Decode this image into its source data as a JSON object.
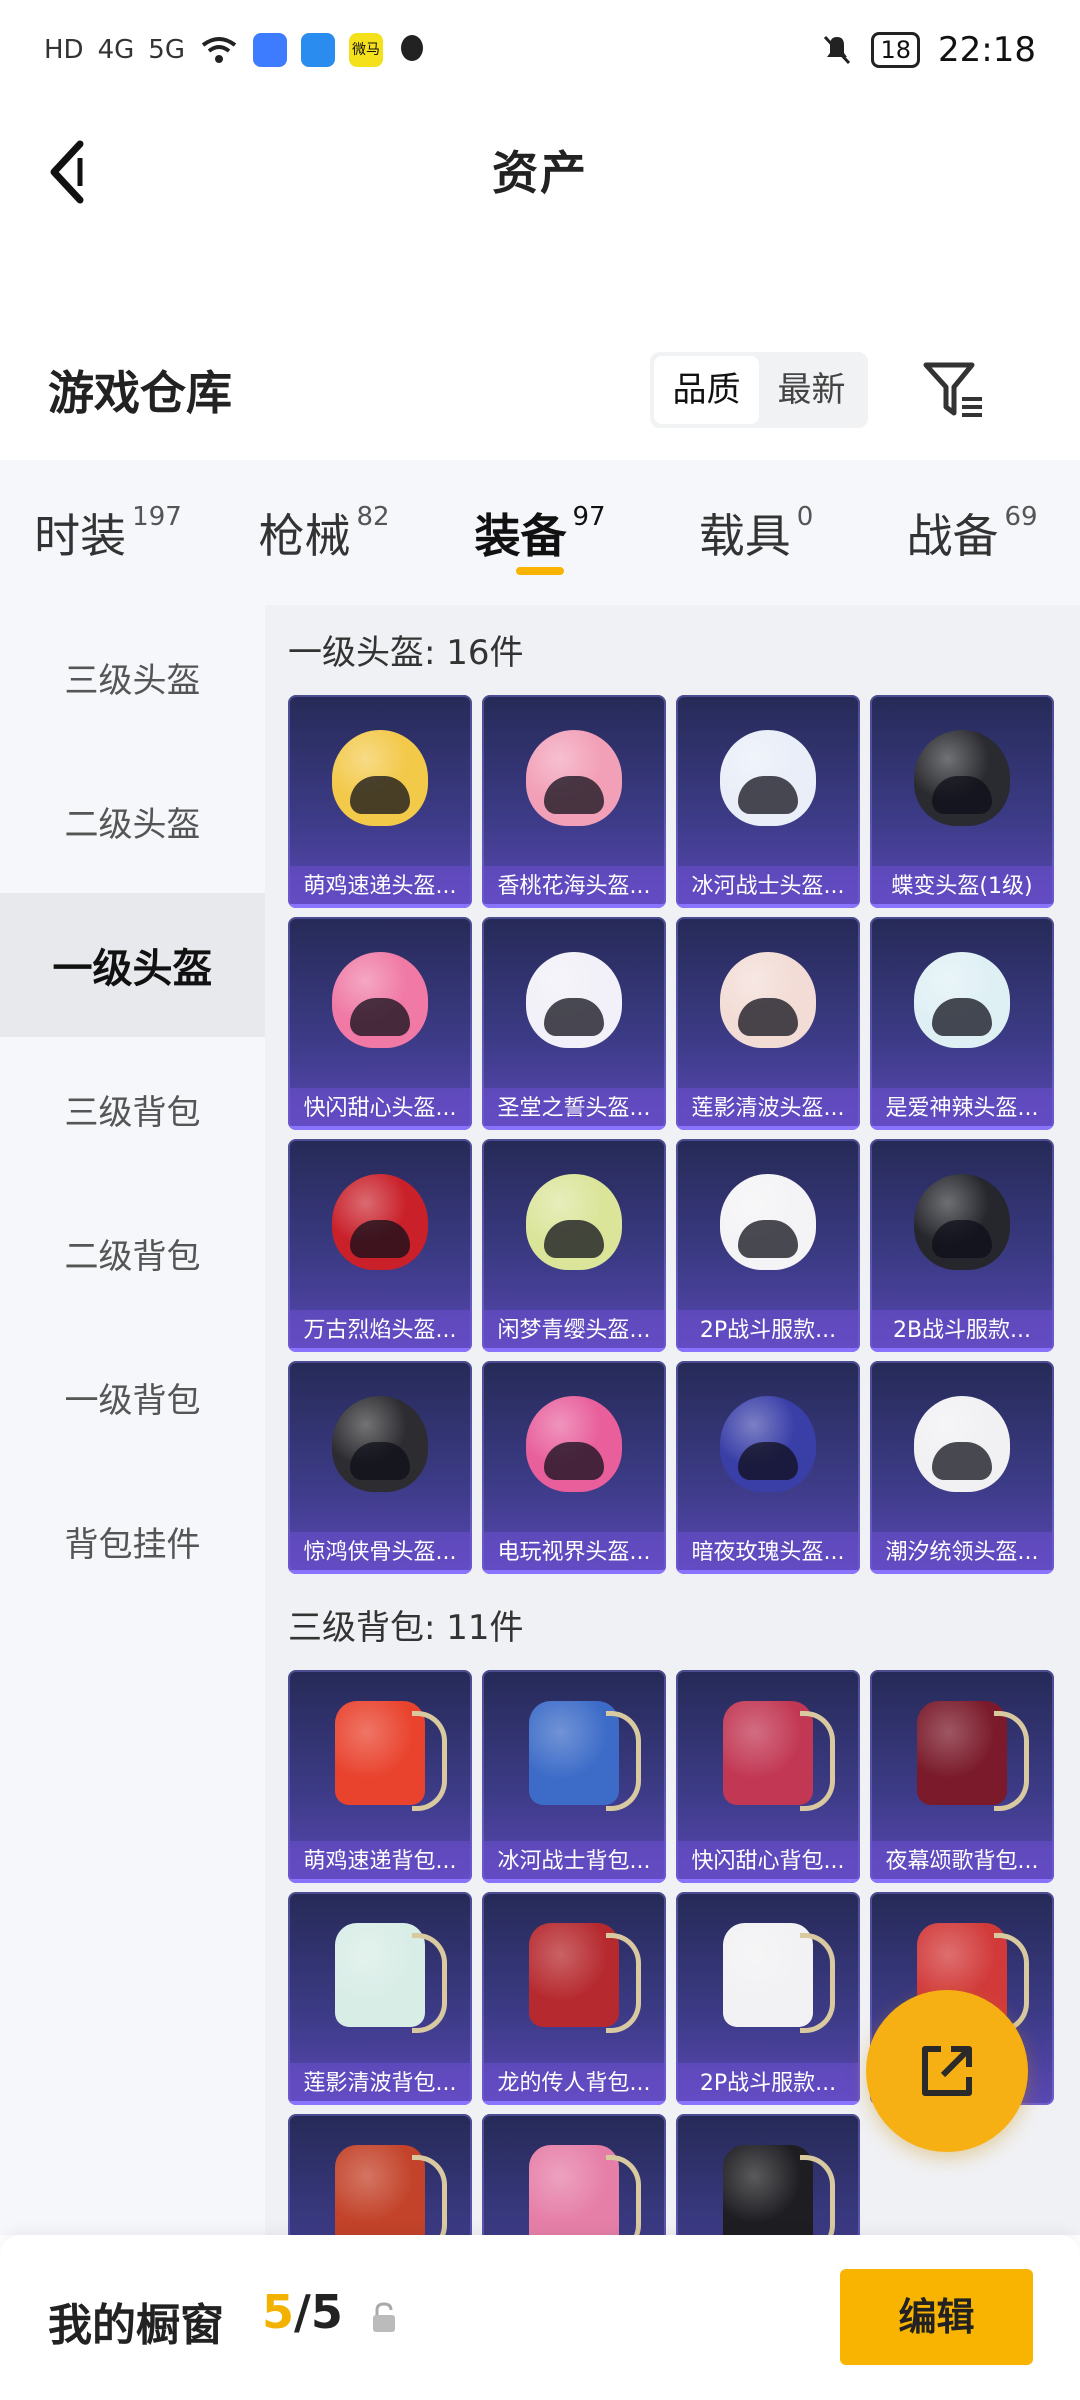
{
  "status_bar": {
    "network_icons": [
      "HD",
      "4G",
      "5G"
    ],
    "app_icon_text": "微马",
    "battery": "18",
    "time": "22:18"
  },
  "nav": {
    "title": "资产",
    "back_icon": "chevron-left-icon"
  },
  "header": {
    "title": "游戏仓库",
    "sort_options": [
      "品质",
      "最新"
    ],
    "sort_selected": "品质",
    "filter_icon": "filter-icon"
  },
  "tabs": [
    {
      "label": "时装",
      "count": "197"
    },
    {
      "label": "枪械",
      "count": "82"
    },
    {
      "label": "装备",
      "count": "97",
      "active": true
    },
    {
      "label": "载具",
      "count": "0"
    },
    {
      "label": "战备",
      "count": "69"
    }
  ],
  "sidebar": {
    "items": [
      {
        "label": "三级头盔"
      },
      {
        "label": "二级头盔"
      },
      {
        "label": "一级头盔",
        "active": true
      },
      {
        "label": "三级背包"
      },
      {
        "label": "二级背包"
      },
      {
        "label": "一级背包"
      },
      {
        "label": "背包挂件"
      }
    ]
  },
  "groups": [
    {
      "title": "一级头盔: 16件",
      "items": [
        {
          "label": "萌鸡速递头盔...",
          "color": "#f3c94a"
        },
        {
          "label": "香桃花海头盔...",
          "color": "#f2a0b8"
        },
        {
          "label": "冰河战士头盔...",
          "color": "#e9eef8"
        },
        {
          "label": "蝶变头盔(1级)",
          "color": "#2a2b30"
        },
        {
          "label": "快闪甜心头盔...",
          "color": "#f07aa5"
        },
        {
          "label": "圣堂之誓头盔...",
          "color": "#f2f0f8"
        },
        {
          "label": "莲影清波头盔...",
          "color": "#f3dcd6"
        },
        {
          "label": "是爱神辣头盔...",
          "color": "#dff0f5"
        },
        {
          "label": "万古烈焰头盔...",
          "color": "#c9202a"
        },
        {
          "label": "闲梦青缨头盔...",
          "color": "#dbe59a"
        },
        {
          "label": "2P战斗服款...",
          "color": "#f4f4f6"
        },
        {
          "label": "2B战斗服款...",
          "color": "#26272d"
        },
        {
          "label": "惊鸿侠骨头盔...",
          "color": "#2d2c30"
        },
        {
          "label": "电玩视界头盔...",
          "color": "#e85f9c"
        },
        {
          "label": "暗夜玫瑰头盔...",
          "color": "#3a3fa8"
        },
        {
          "label": "潮汐统领头盔...",
          "color": "#f1f1f4"
        }
      ]
    },
    {
      "title": "三级背包: 11件",
      "items": [
        {
          "label": "萌鸡速递背包...",
          "color": "#e9432e"
        },
        {
          "label": "冰河战士背包...",
          "color": "#3d6cc8"
        },
        {
          "label": "快闪甜心背包...",
          "color": "#c23854"
        },
        {
          "label": "夜幕颂歌背包...",
          "color": "#7a1a2a"
        },
        {
          "label": "莲影清波背包...",
          "color": "#d9ede7"
        },
        {
          "label": "龙的传人背包...",
          "color": "#b62a2f"
        },
        {
          "label": "2P战斗服款...",
          "color": "#f2f2f4"
        },
        {
          "label": "",
          "color": "#d23a3a"
        },
        {
          "label": "",
          "color": "#c3432a"
        },
        {
          "label": "",
          "color": "#e67fa8"
        },
        {
          "label": "",
          "color": "#1e1e22"
        }
      ]
    }
  ],
  "bottom_bar": {
    "label": "我的橱窗",
    "count_current": "5",
    "count_sep": "/",
    "count_total": "5",
    "edit_label": "编辑"
  },
  "fab_icon": "share-external-icon"
}
